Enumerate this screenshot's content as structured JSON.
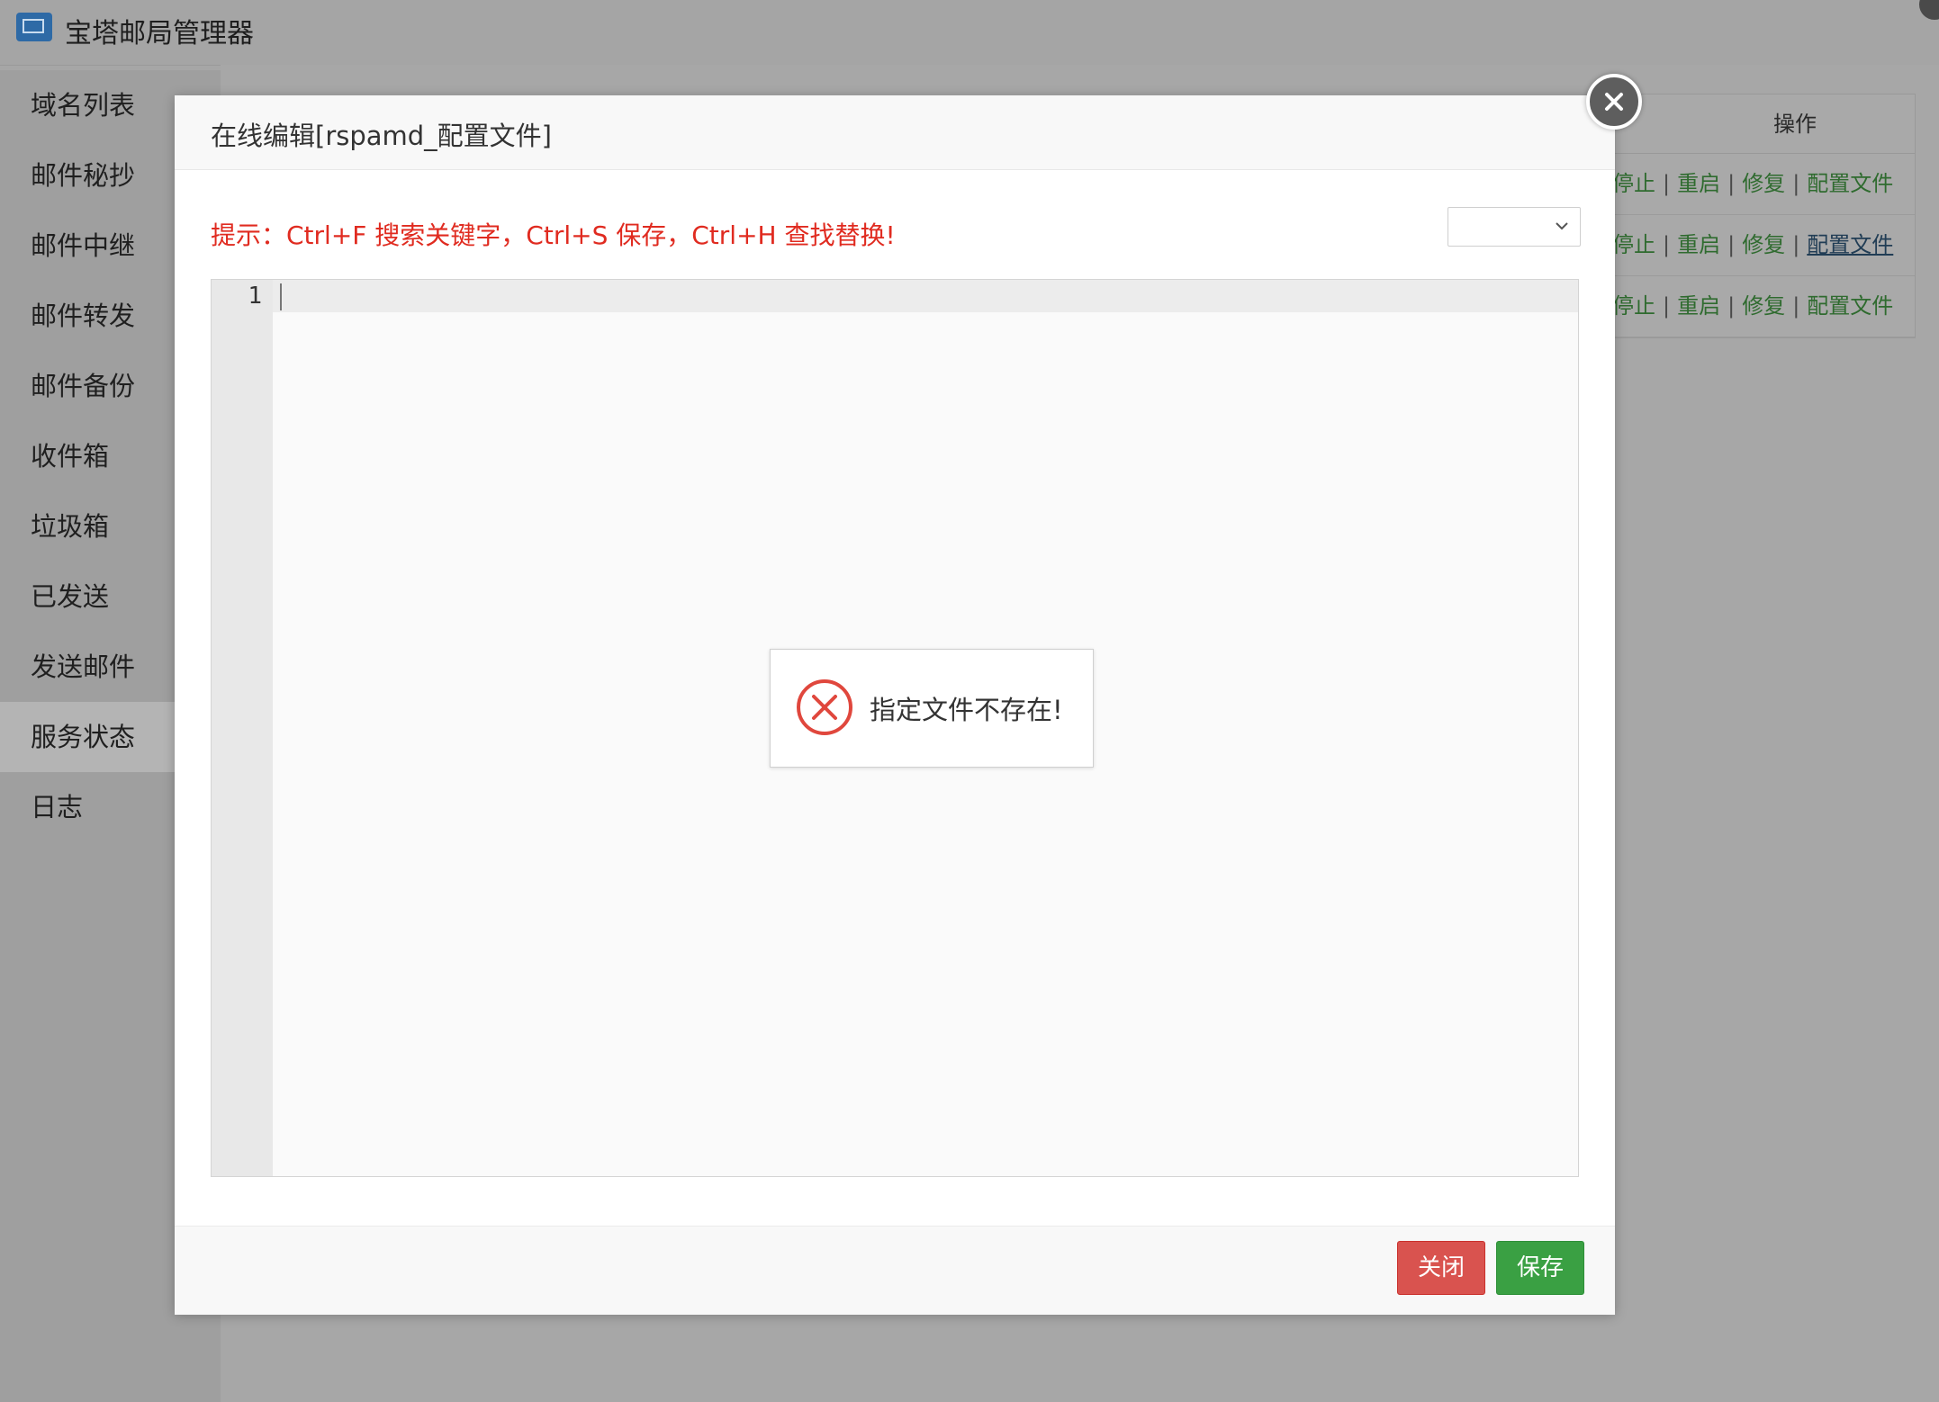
{
  "app": {
    "title": "宝塔邮局管理器"
  },
  "sidebar": {
    "items": [
      {
        "label": "域名列表"
      },
      {
        "label": "邮件秘抄"
      },
      {
        "label": "邮件中继"
      },
      {
        "label": "邮件转发"
      },
      {
        "label": "邮件备份"
      },
      {
        "label": "收件箱"
      },
      {
        "label": "垃圾箱"
      },
      {
        "label": "已发送"
      },
      {
        "label": "发送邮件"
      },
      {
        "label": "服务状态",
        "active": true
      },
      {
        "label": "日志"
      }
    ]
  },
  "service_table": {
    "header_actions": "操作",
    "rows": [
      {
        "stop": "停止",
        "restart": "重启",
        "repair": "修复",
        "config": "配置文件"
      },
      {
        "stop": "停止",
        "restart": "重启",
        "repair": "修复",
        "config": "配置文件"
      },
      {
        "stop": "停止",
        "restart": "重启",
        "repair": "修复",
        "config": "配置文件"
      }
    ]
  },
  "dialog": {
    "title": "在线编辑[rspamd_配置文件]",
    "tip": "提示：Ctrl+F 搜索关键字，Ctrl+S 保存，Ctrl+H 查找替换!",
    "select_value": "",
    "editor": {
      "line_numbers": [
        "1"
      ],
      "content": ""
    },
    "error_message": "指定文件不存在!",
    "buttons": {
      "close": "关闭",
      "save": "保存"
    }
  },
  "colors": {
    "tip": "#e02b20",
    "close_button": "#d9534f",
    "save_button": "#3aa043",
    "error_icon": "#e0473d"
  }
}
